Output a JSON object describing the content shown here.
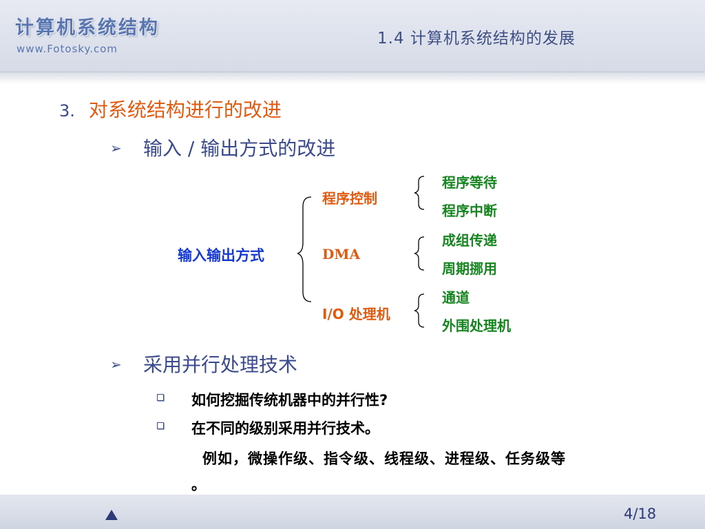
{
  "header": {
    "brand": "计算机系统结构",
    "site": "www.Fotosky.com",
    "section_title": "1.4  计算机系统结构的发展"
  },
  "content": {
    "item_number": "3.",
    "item_title": "对系统结构进行的改进",
    "bullet1": "输入 / 输出方式的改进",
    "bullet2": "采用并行处理技术",
    "diagram": {
      "root": "输入输出方式",
      "branches": [
        {
          "label": "程序控制",
          "leaves": [
            "程序等待",
            "程序中断"
          ]
        },
        {
          "label": "DMA",
          "leaves": [
            "成组传递",
            "周期挪用"
          ]
        },
        {
          "label": "I/O 处理机",
          "leaves": [
            "通道",
            "外围处理机"
          ]
        }
      ]
    },
    "subitems": [
      "如何挖掘传统机器中的并行性?",
      "在不同的级别采用并行技术。"
    ],
    "example_line": "例如，微操作级、指令级、线程级、进程级、任务级等",
    "example_end": "。"
  },
  "footer": {
    "pager": "4/18",
    "prev_icon": "up-triangle-icon"
  },
  "colors": {
    "title_orange": "#e05a10",
    "text_navy": "#3b4a8c",
    "root_blue": "#1538d1",
    "leaf_green": "#15851f"
  }
}
